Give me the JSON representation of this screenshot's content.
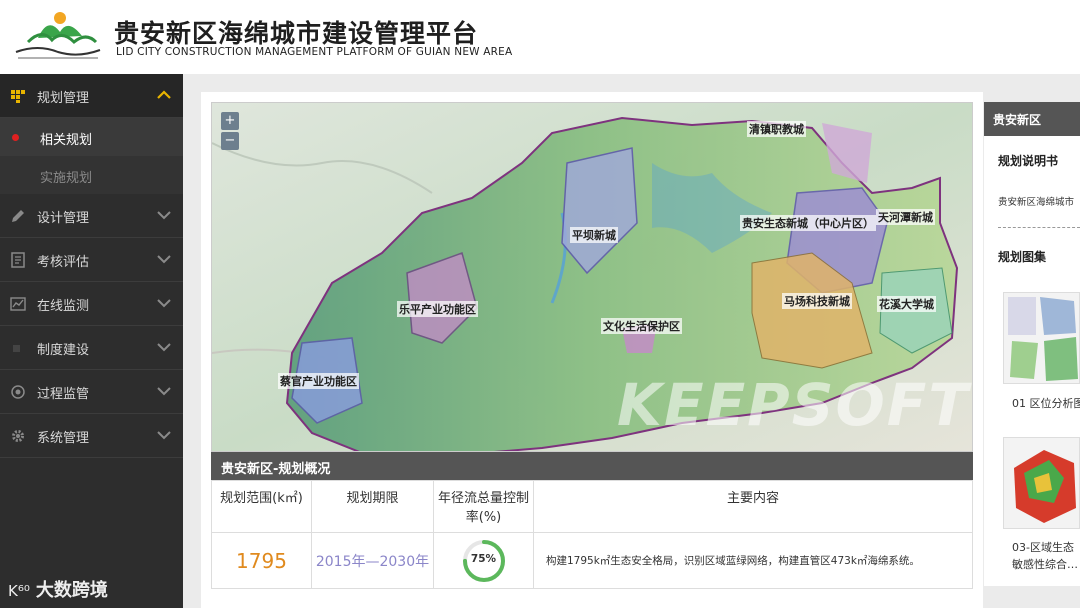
{
  "header": {
    "title": "贵安新区海绵城市建设管理平台",
    "subtitle": "LID CITY CONSTRUCTION MANAGEMENT PLATFORM OF GUIAN NEW AREA"
  },
  "sidebar": {
    "items": [
      {
        "label": "规划管理",
        "icon": "grid-icon",
        "expanded": true,
        "children": [
          {
            "label": "相关规划",
            "active": true
          },
          {
            "label": "实施规划",
            "active": false
          }
        ]
      },
      {
        "label": "设计管理",
        "icon": "pencil-icon"
      },
      {
        "label": "考核评估",
        "icon": "clipboard-icon"
      },
      {
        "label": "在线监测",
        "icon": "chart-line-icon"
      },
      {
        "label": "制度建设",
        "icon": "square-icon"
      },
      {
        "label": "过程监管",
        "icon": "target-icon"
      },
      {
        "label": "系统管理",
        "icon": "gear-icon"
      }
    ],
    "brand": "大数跨境"
  },
  "map": {
    "zoom_in": "+",
    "zoom_out": "−",
    "labels": [
      "清镇职教城",
      "平坝新城",
      "贵安生态新城（中心片区）",
      "天河潭新城",
      "乐平产业功能区",
      "文化生活保护区",
      "马场科技新城",
      "花溪大学城",
      "蔡官产业功能区"
    ],
    "watermark": "KEEPSOFT"
  },
  "overview": {
    "title": "贵安新区-规划概况",
    "headers": [
      "规划范围(k㎡)",
      "规划期限",
      "年径流总量控制率(%)",
      "主要内容"
    ],
    "range": "1795",
    "period": "2015年—2030年",
    "rate_label": "75%",
    "rate_value": 75,
    "content": "构建1795k㎡生态安全格局，识别区域蓝绿网络，构建直管区473k㎡海绵系统。"
  },
  "right_panel": {
    "title": "贵安新区",
    "section_doc": "规划说明书",
    "doc_item": "贵安新区海绵城市",
    "section_atlas": "规划图集",
    "atlas": [
      "01 区位分析图",
      "03-区域生态敏感性综合…"
    ]
  },
  "colors": {
    "accent_orange": "#e08a1e",
    "period_purple": "#8b86c9",
    "ring_green": "#5cb85c",
    "dot_red": "#e02020"
  }
}
